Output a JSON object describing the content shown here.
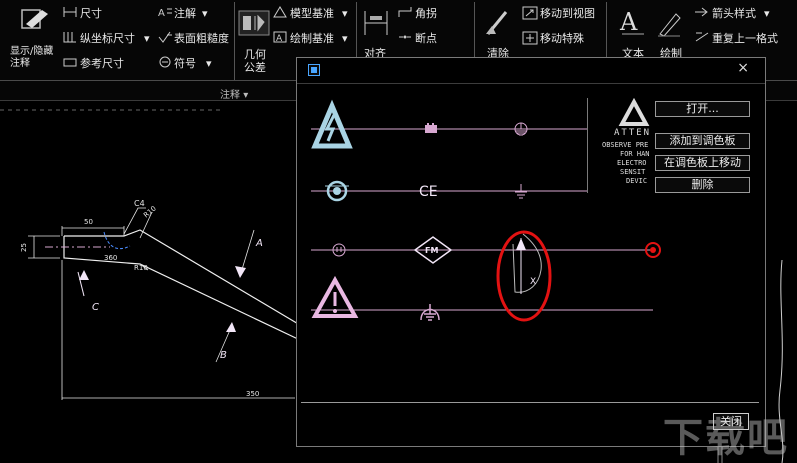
{
  "ribbon": {
    "col1": {
      "big_label": "显示/隐藏注释"
    },
    "dimension_items": [
      {
        "label": "尺寸",
        "arrow": ""
      },
      {
        "label": "纵坐标尺寸",
        "arrow": "▾"
      },
      {
        "label": "参考尺寸",
        "arrow": ""
      }
    ],
    "note_items": [
      {
        "label": "注解",
        "arrow": "▾"
      },
      {
        "label": "表面粗糙度",
        "arrow": ""
      },
      {
        "label": "符号",
        "arrow": "▾"
      }
    ],
    "datum_items": [
      {
        "label": "模型基准",
        "arrow": "▾"
      },
      {
        "label": "绘制基准",
        "arrow": "▾"
      }
    ],
    "geometric_tolerance_label": "几何公差",
    "align_label": "对齐",
    "align_items": [
      {
        "label": "角拐"
      },
      {
        "label": "断点"
      }
    ],
    "clean_label": "清除",
    "move_items": [
      {
        "label": "移动到视图"
      },
      {
        "label": "移动特殊"
      }
    ],
    "text_label": "文本",
    "sketch_label": "绘制",
    "arrow_items": [
      {
        "label": "箭头样式",
        "arrow": "▾"
      },
      {
        "label": "重复上一格式",
        "arrow": ""
      }
    ],
    "group_label": "注释",
    "group_arrow": "▾"
  },
  "drawing": {
    "dims": {
      "d50": "50",
      "c4": "C4",
      "r10_top": "R10",
      "r10_bottom": "R10",
      "d25": "25",
      "d360": "360",
      "d350": "350",
      "label_a": "A",
      "label_b": "B",
      "label_c": "C"
    }
  },
  "dialog": {
    "close_glyph": "×",
    "preview_lines": [
      "ATTEN",
      "OBSERVE PRE",
      "FOR HAN",
      "ELECTRO",
      "SENSIT",
      "DEVIC"
    ],
    "buttons": {
      "open": "打开...",
      "add_to_palette": "添加到调色板",
      "move_on_palette": "在调色板上移动",
      "delete": "删除",
      "close": "关闭"
    },
    "symbol_text": {
      "ce": "CE",
      "fm": "FM",
      "x_label": "X"
    },
    "colors": {
      "line": "#d7a8d1",
      "accent_blue": "#a9d4e4",
      "highlight_circle": "#e31212",
      "tile_green": "#7fe0a6"
    }
  },
  "watermark": "下载吧"
}
